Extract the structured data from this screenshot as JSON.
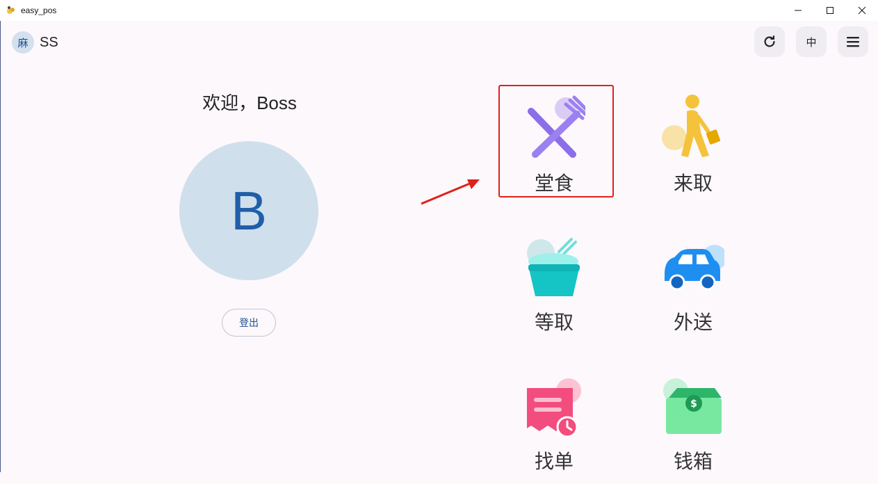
{
  "window": {
    "title": "easy_pos"
  },
  "header": {
    "user_badge": "麻",
    "user_name": "SS",
    "lang_label": "中",
    "icons": [
      "refresh-icon",
      "hamburger-menu-icon"
    ]
  },
  "left": {
    "welcome": "欢迎，Boss",
    "avatar_letter": "B",
    "logout_label": "登出"
  },
  "tiles": [
    {
      "label": "堂食",
      "icon": "utensils-icon",
      "color": "#8b6ee8",
      "highlighted": true
    },
    {
      "label": "来取",
      "icon": "walking-person-icon",
      "color": "#f5c23c"
    },
    {
      "label": "等取",
      "icon": "noodle-bowl-icon",
      "color": "#15c4c4"
    },
    {
      "label": "外送",
      "icon": "car-icon",
      "color": "#1e8ff0"
    },
    {
      "label": "找单",
      "icon": "receipt-clock-icon",
      "color": "#f24d7e"
    },
    {
      "label": "钱箱",
      "icon": "cash-box-icon",
      "color": "#5fd79a"
    }
  ],
  "colors": {
    "accent_blue": "#1e4f8d",
    "highlight_red": "#e0201a",
    "background": "#fdf8fc"
  }
}
